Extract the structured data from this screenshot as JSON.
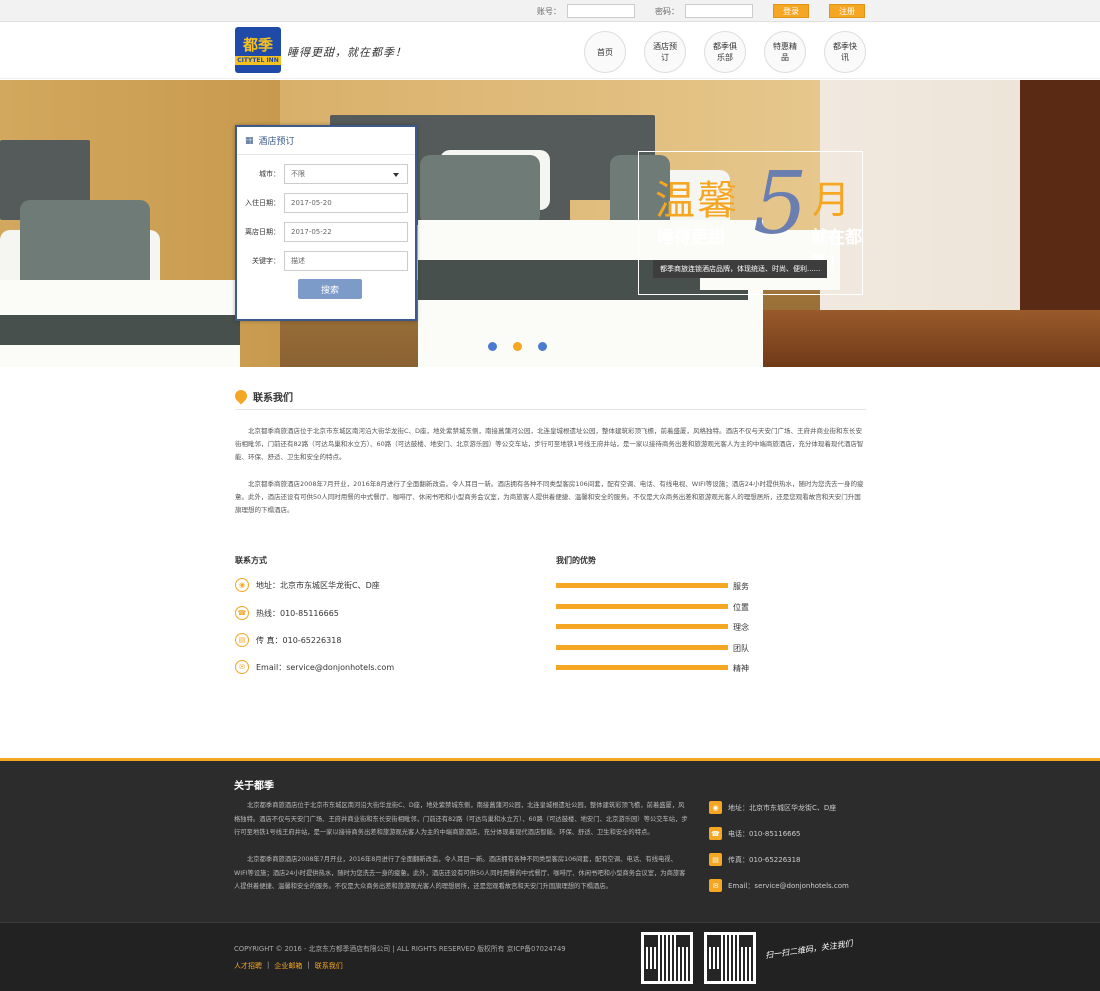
{
  "topbar": {
    "account_label": "账号：",
    "password_label": "密码：",
    "login_btn": "登录",
    "register_btn": "注册"
  },
  "header": {
    "logo_cn": "都季",
    "logo_en": "CITYTEL INN",
    "slogan": "睡得更甜，就在都季！",
    "nav": [
      "首页",
      "酒店预订",
      "都季俱乐部",
      "特惠精品",
      "都季快讯"
    ]
  },
  "booking": {
    "title": "酒店预订",
    "city_label": "城市：",
    "city_value": "不限",
    "checkin_label": "入住日期：",
    "checkin_value": "2017-05-20",
    "checkout_label": "离店日期：",
    "checkout_value": "2017-05-22",
    "keyword_label": "关键字：",
    "keyword_placeholder": "描述",
    "search_btn": "搜索"
  },
  "promo": {
    "line1": "温馨",
    "number": "5",
    "month": "月",
    "line2a": "睡得更甜",
    "line2b": "就在都季！",
    "tag": "都季商旅连锁酒店品牌，体现统适、时尚、便利......"
  },
  "contact_section": {
    "title": "联系我们",
    "para1": "北京都季商旅酒店位于北京市东城区南河沿大街华龙街C、D座，地处紫禁城东侧，南接菖蒲河公园，北连皇城根遗址公园，整体建筑彩顶飞檐，前着盛厦，风格独特。酒店不仅与天安门广场、王府井商业街和东长安街相毗邻，门前还有82路（可达鸟巢和水立方）、60路（可达鼓楼、地安门、北京游乐园）等公交车站，步行可至地铁1号线王府井站，是一家以接待商务出差和旅游观光客人为主的中端商旅酒店，充分体现着现代酒店智能、环保、舒适、卫生和安全的特点。",
    "para2": "北京都季商旅酒店2008年7月开业，2016年8月进行了全面翻新改造，令人耳目一新。酒店拥有各种不同类型客房106间套，配有空调、电话、有线电视、WIFI等设施；酒店24小时提供热水，随时为您洗去一身的疲惫。此外，酒店还设有可供50人同时用餐的中式餐厅、咖啡厅、休闲书吧和小型商务会议室，为商旅客人提供着便捷、温馨和安全的服务。不仅是大众商务出差和旅游观光客人的理想居所，还是您观看故宫和天安门升国旗理想的下榻酒店。",
    "contact_title": "联系方式",
    "contacts": [
      "地址：北京市东城区华龙街C、D座",
      "热线：010-85116665",
      "传 真：010-65226318",
      "Email：service@donjonhotels.com"
    ],
    "advantage_title": "我们的优势",
    "advantages": [
      "服务",
      "位置",
      "理念",
      "团队",
      "精神"
    ],
    "advantage_levels": [
      1,
      1,
      1,
      1,
      1
    ]
  },
  "footer": {
    "title": "关于都季",
    "para1": "北京都季商旅酒店位于北京市东城区南河沿大街华龙街C、D座，地处紫禁城东侧，南接菖蒲河公园，北连皇城根遗址公园，整体建筑彩顶飞檐，前着盛厦，风格独特。酒店不仅与天安门广场、王府井商业街和东长安街相毗邻，门前还有82路（可达鸟巢和水立方）、60路（可达鼓楼、地安门、北京游乐园）等公交车站，步行可至地铁1号线王府井站，是一家以接待商务出差和旅游观光客人为主的中端商旅酒店，充分体现着现代酒店智能、环保、舒适、卫生和安全的特点。",
    "para2": "北京都季商旅酒店2008年7月开业，2016年8月进行了全面翻新改造，令人耳目一新。酒店拥有各种不同类型客房106间套，配有空调、电话、有线电视、WIFI等设施；酒店24小时提供热水，随时为您洗去一身的疲惫。此外，酒店还设有可供50人同时用餐的中式餐厅、咖啡厅、休闲书吧和小型商务会议室，为商旅客人提供着便捷、温馨和安全的服务。不仅是大众商务出差和旅游观光客人的理想居所，还是您观看故宫和天安门升国旗理想的下榻酒店。",
    "contacts": [
      "地址：北京市东城区华龙街C、D座",
      "电话：010-85116665",
      "传真：010-65226318",
      "Email：service@donjonhotels.com"
    ],
    "copyright": "COPYRIGHT © 2016 - 北京东方都季酒店有限公司   | ALL RIGHTS RESERVED     版权所有 京ICP备07024749",
    "links": [
      "人才招聘",
      "企业邮箱",
      "联系我们"
    ],
    "scan_text": "扫一扫二维码，关注我们"
  },
  "colors": {
    "accent": "#f5a623",
    "brand": "#1f4aa8",
    "footer_bg": "#2c2c2c"
  }
}
